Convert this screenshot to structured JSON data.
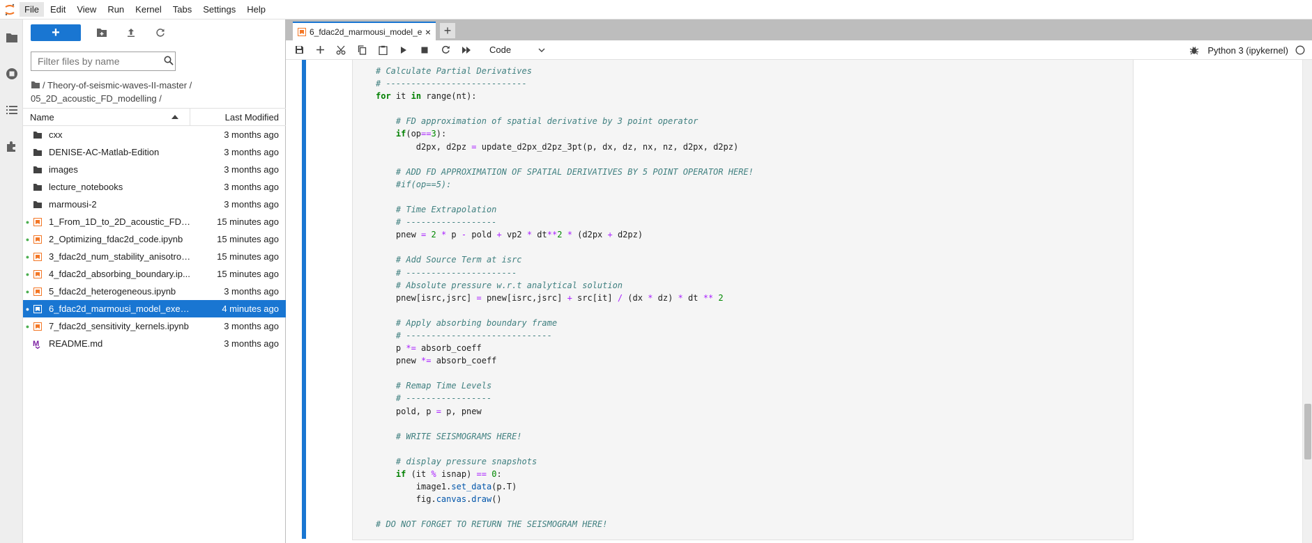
{
  "menu": [
    "File",
    "Edit",
    "View",
    "Run",
    "Kernel",
    "Tabs",
    "Settings",
    "Help"
  ],
  "filebrowser": {
    "new_label": "+",
    "filter_placeholder": "Filter files by name",
    "breadcrumb": "/ Theory-of-seismic-waves-II-master / 05_2D_acoustic_FD_modelling /",
    "col_name": "Name",
    "col_modified": "Last Modified",
    "files": [
      {
        "name": "cxx",
        "modified": "3 months ago",
        "kind": "folder",
        "running": false
      },
      {
        "name": "DENISE-AC-Matlab-Edition",
        "modified": "3 months ago",
        "kind": "folder",
        "running": false
      },
      {
        "name": "images",
        "modified": "3 months ago",
        "kind": "folder",
        "running": false
      },
      {
        "name": "lecture_notebooks",
        "modified": "3 months ago",
        "kind": "folder",
        "running": false
      },
      {
        "name": "marmousi-2",
        "modified": "3 months ago",
        "kind": "folder",
        "running": false
      },
      {
        "name": "1_From_1D_to_2D_acoustic_FD_m...",
        "modified": "15 minutes ago",
        "kind": "notebook",
        "running": true
      },
      {
        "name": "2_Optimizing_fdac2d_code.ipynb",
        "modified": "15 minutes ago",
        "kind": "notebook",
        "running": true
      },
      {
        "name": "3_fdac2d_num_stability_anisotrop...",
        "modified": "15 minutes ago",
        "kind": "notebook",
        "running": true
      },
      {
        "name": "4_fdac2d_absorbing_boundary.ip...",
        "modified": "15 minutes ago",
        "kind": "notebook",
        "running": true
      },
      {
        "name": "5_fdac2d_heterogeneous.ipynb",
        "modified": "3 months ago",
        "kind": "notebook",
        "running": true
      },
      {
        "name": "6_fdac2d_marmousi_model_exerci...",
        "modified": "4 minutes ago",
        "kind": "notebook",
        "running": true,
        "selected": true
      },
      {
        "name": "7_fdac2d_sensitivity_kernels.ipynb",
        "modified": "3 months ago",
        "kind": "notebook",
        "running": true
      },
      {
        "name": "README.md",
        "modified": "3 months ago",
        "kind": "markdown",
        "running": false
      }
    ]
  },
  "tab": {
    "label": "6_fdac2d_marmousi_model_e",
    "close": "×",
    "add": "+"
  },
  "toolbar": {
    "cell_type": "Code",
    "kernel": "Python 3 (ipykernel)"
  },
  "code_lines": [
    "# Calculate Partial Derivatives",
    "# ----------------------------",
    "for it in range(nt):",
    "",
    "    # FD approximation of spatial derivative by 3 point operator",
    "    if(op==3):",
    "        d2px, d2pz = update_d2px_d2pz_3pt(p, dx, dz, nx, nz, d2px, d2pz)",
    "",
    "    # ADD FD APPROXIMATION OF SPATIAL DERIVATIVES BY 5 POINT OPERATOR HERE!",
    "    #if(op==5):",
    "",
    "    # Time Extrapolation",
    "    # ------------------",
    "    pnew = 2 * p - pold + vp2 * dt**2 * (d2px + d2pz)",
    "",
    "    # Add Source Term at isrc",
    "    # ----------------------",
    "    # Absolute pressure w.r.t analytical solution",
    "    pnew[isrc,jsrc] = pnew[isrc,jsrc] + src[it] / (dx * dz) * dt ** 2",
    "",
    "    # Apply absorbing boundary frame",
    "    # -----------------------------",
    "    p *= absorb_coeff",
    "    pnew *= absorb_coeff",
    "",
    "    # Remap Time Levels",
    "    # -----------------",
    "    pold, p = p, pnew",
    "",
    "    # WRITE SEISMOGRAMS HERE!",
    "",
    "    # display pressure snapshots",
    "    if (it % isnap) == 0:",
    "        image1.set_data(p.T)",
    "        fig.canvas.draw()",
    "",
    "# DO NOT FORGET TO RETURN THE SEISMOGRAM HERE!"
  ],
  "colors": {
    "accent": "#1976d2",
    "comment": "#408080",
    "keyword": "#008000",
    "operator": "#aa22ff"
  }
}
